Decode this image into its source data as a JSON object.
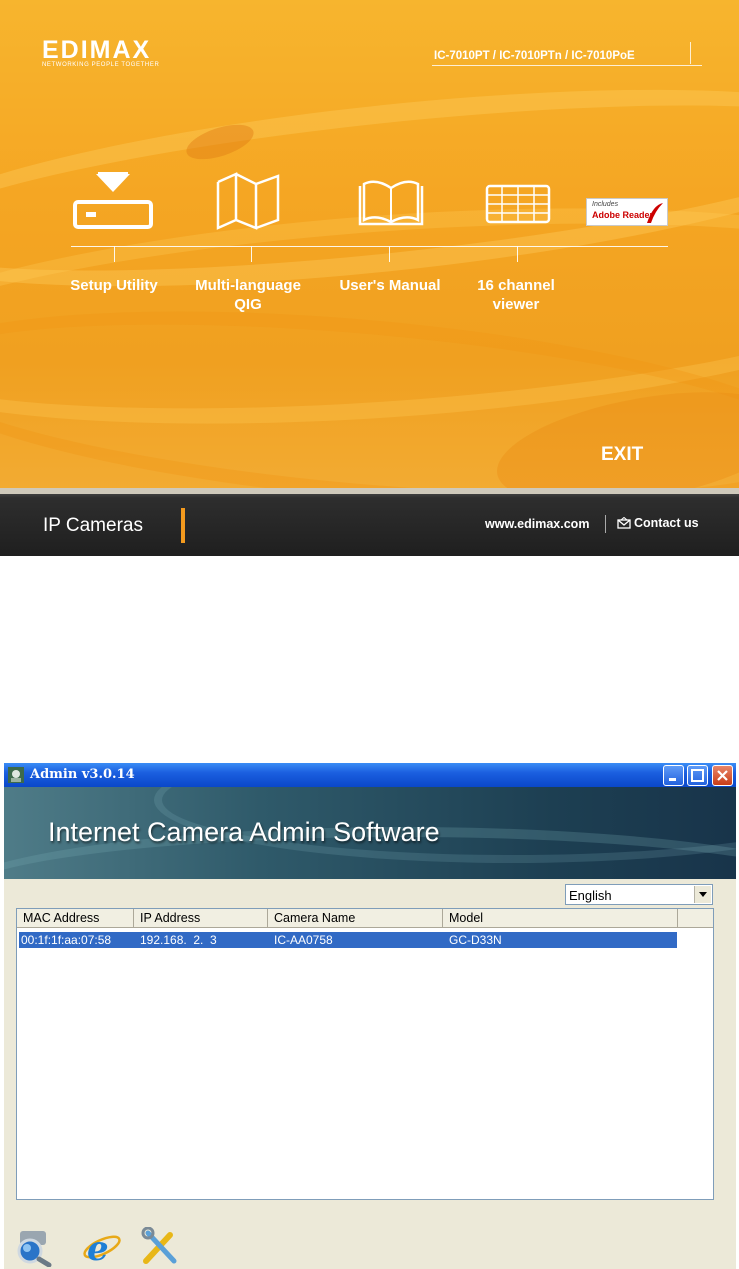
{
  "autorun": {
    "brand_logo": "EDIMAX",
    "brand_tagline": "NETWORKING PEOPLE TOGETHER",
    "models": "IC-7010PT / IC-7010PTn / IC-7010PoE",
    "menu": [
      {
        "label": "Setup Utility",
        "icon": "setup-utility-icon"
      },
      {
        "label": "Multi-language QIG",
        "icon": "map-icon"
      },
      {
        "label": "User's Manual",
        "icon": "open-book-icon"
      },
      {
        "label": "16 channel viewer",
        "icon": "grid-viewer-icon"
      }
    ],
    "adobe": {
      "line1": "Includes",
      "line2": "Adobe Reader"
    },
    "exit": "EXIT",
    "footer": {
      "section": "IP Cameras",
      "website": "www.edimax.com",
      "contact": "Contact us"
    },
    "colors": {
      "background": "#f5a623",
      "accent": "#f39a1e",
      "footer": "#1f1f1f"
    }
  },
  "admin": {
    "window_title": "Admin v3.0.14",
    "banner_title": "Internet Camera Admin Software",
    "language": "English",
    "columns": [
      "MAC Address",
      "IP Address",
      "Camera Name",
      "Model"
    ],
    "rows": [
      [
        "00:1f:1f:aa:07:58",
        "192.168.  2.  3",
        "IC-AA0758",
        "GC-D33N"
      ]
    ],
    "tools": [
      "search-camera-icon",
      "internet-explorer-icon",
      "setup-tools-icon"
    ],
    "colors": {
      "titlebar": "#0a47c9",
      "selection": "#316ac5",
      "window": "#ece9d8"
    }
  }
}
